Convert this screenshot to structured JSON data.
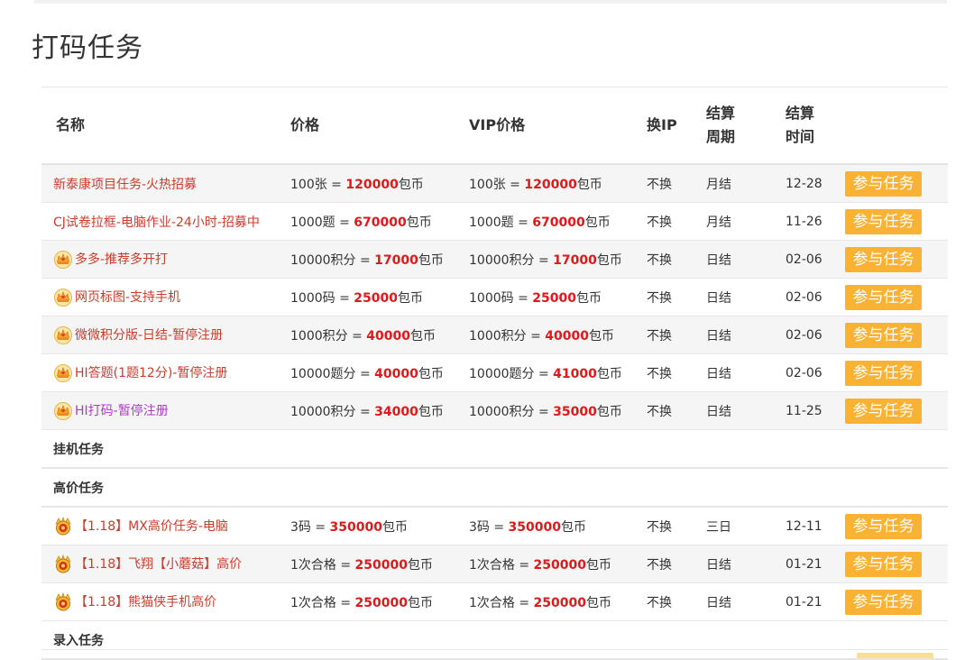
{
  "page": {
    "title": "打码任务"
  },
  "table": {
    "headers": {
      "name": "名称",
      "price": "价格",
      "vip_price": "VIP价格",
      "ip": "换IP",
      "period_line1": "结算",
      "period_line2": "周期",
      "time_line1": "结算",
      "time_line2": "时间"
    },
    "button_label": "参与任务",
    "currency": "包币",
    "rows": [
      {
        "kind": "task",
        "badge": "none",
        "name": "新泰康项目任务-火热招募",
        "price_pre": "100张 = ",
        "price_num": "120000",
        "vip_pre": "100张 = ",
        "vip_num": "120000",
        "ip": "不换",
        "period": "月结",
        "time": "12-28"
      },
      {
        "kind": "task",
        "badge": "none",
        "name": "CJ试卷拉框-电脑作业-24小时-招募中",
        "price_pre": "1000题 = ",
        "price_num": "670000",
        "vip_pre": "1000题 = ",
        "vip_num": "670000",
        "ip": "不换",
        "period": "月结",
        "time": "11-26"
      },
      {
        "kind": "task",
        "badge": "crown",
        "name": "多多-推荐多开打",
        "price_pre": "10000积分 = ",
        "price_num": "17000",
        "vip_pre": "10000积分 = ",
        "vip_num": "17000",
        "ip": "不换",
        "period": "日结",
        "time": "02-06"
      },
      {
        "kind": "task",
        "badge": "crown",
        "name": "网页标图-支持手机",
        "price_pre": "1000码 = ",
        "price_num": "25000",
        "vip_pre": "1000码 = ",
        "vip_num": "25000",
        "ip": "不换",
        "period": "日结",
        "time": "02-06"
      },
      {
        "kind": "task",
        "badge": "crown",
        "name": "微微积分版-日结-暂停注册",
        "price_pre": "1000积分 = ",
        "price_num": "40000",
        "vip_pre": "1000积分 = ",
        "vip_num": "40000",
        "ip": "不换",
        "period": "日结",
        "time": "02-06"
      },
      {
        "kind": "task",
        "badge": "crown",
        "name": "HI答题(1题12分)-暂停注册",
        "price_pre": "10000题分 = ",
        "price_num": "40000",
        "vip_pre": "10000题分 = ",
        "vip_num": "41000",
        "ip": "不换",
        "period": "日结",
        "time": "02-06"
      },
      {
        "kind": "task",
        "badge": "crown",
        "purple": true,
        "name": "HI打码-暂停注册",
        "price_pre": "10000积分 = ",
        "price_num": "34000",
        "vip_pre": "10000积分 = ",
        "vip_num": "35000",
        "ip": "不换",
        "period": "日结",
        "time": "11-25"
      },
      {
        "kind": "category",
        "label": "挂机任务"
      },
      {
        "kind": "category",
        "label": "高价任务"
      },
      {
        "kind": "task",
        "badge": "medal",
        "name": "【1.18】MX高价任务-电脑",
        "price_pre": "3码 = ",
        "price_num": "350000",
        "vip_pre": "3码 = ",
        "vip_num": "350000",
        "ip": "不换",
        "period": "三日",
        "time": "12-11"
      },
      {
        "kind": "task",
        "badge": "medal",
        "name": "【1.18】飞翔【小蘑菇】高价",
        "price_pre": "1次合格 = ",
        "price_num": "250000",
        "vip_pre": "1次合格 = ",
        "vip_num": "250000",
        "ip": "不换",
        "period": "日结",
        "time": "01-21"
      },
      {
        "kind": "task",
        "badge": "medal",
        "name": "【1.18】熊猫侠手机高价",
        "price_pre": "1次合格 = ",
        "price_num": "250000",
        "vip_pre": "1次合格 = ",
        "vip_num": "250000",
        "ip": "不换",
        "period": "日结",
        "time": "01-21"
      },
      {
        "kind": "category",
        "label": "录入任务"
      }
    ]
  },
  "colors": {
    "name_link": "#cc3b2b",
    "name_link_alt": "#b03ac8",
    "price_highlight": "#e0181b",
    "button_bg": "#f9b233",
    "row_stripe": "#f5f5f5"
  },
  "icons": {
    "crown": "crown-badge-icon",
    "medal": "medal-badge-icon"
  }
}
